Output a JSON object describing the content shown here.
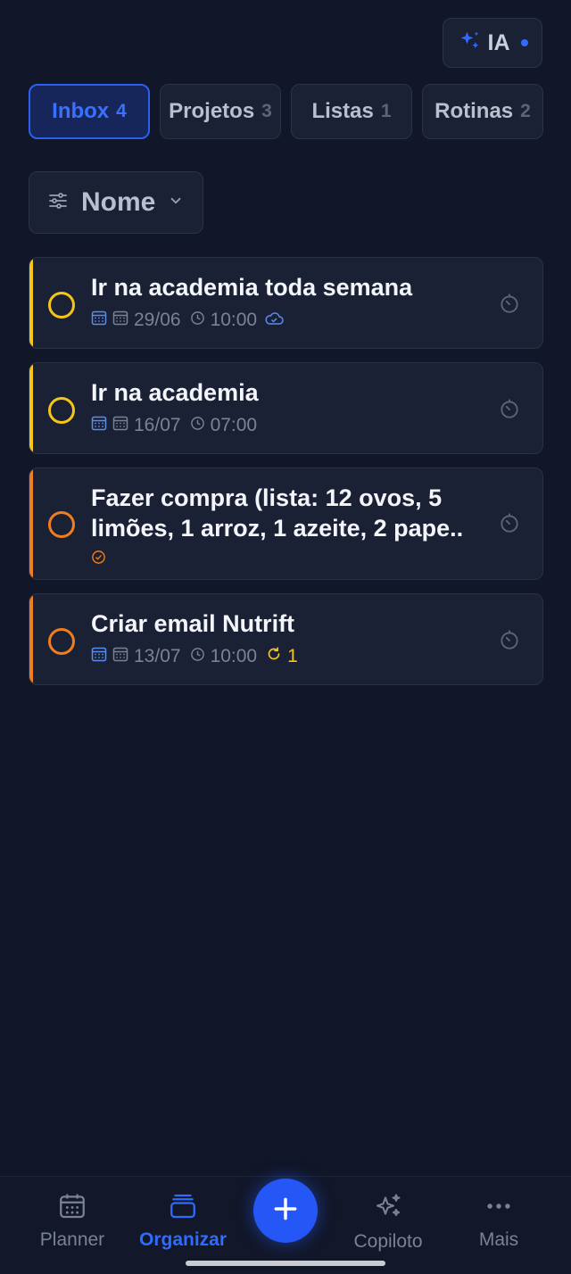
{
  "header": {
    "ia_label": "IA"
  },
  "tabs": [
    {
      "label": "Inbox",
      "count": "4",
      "active": true
    },
    {
      "label": "Projetos",
      "count": "3",
      "active": false
    },
    {
      "label": "Listas",
      "count": "1",
      "active": false
    },
    {
      "label": "Rotinas",
      "count": "2",
      "active": false
    }
  ],
  "sort": {
    "label": "Nome"
  },
  "tasks": [
    {
      "title": "Ir na academia toda semana",
      "date": "29/06",
      "time": "10:00",
      "priority_color": "#f5c518",
      "extra": "cloud"
    },
    {
      "title": "Ir na academia",
      "date": "16/07",
      "time": "07:00",
      "priority_color": "#f5c518",
      "extra": ""
    },
    {
      "title_line1": "Fazer compra (lista: 12 ovos, 5",
      "title_line2": "limões, 1 arroz, 1 azeite, 2 pape..",
      "priority_color": "#f07d1e",
      "extra": "check"
    },
    {
      "title": "Criar email Nutrift",
      "date": "13/07",
      "time": "10:00",
      "repeat_count": "1",
      "priority_color": "#f07d1e",
      "extra": "repeat"
    }
  ],
  "nav": {
    "planner": "Planner",
    "organizar": "Organizar",
    "copiloto": "Copiloto",
    "mais": "Mais"
  },
  "colors": {
    "accent": "#2f6bff",
    "background": "#111628",
    "card": "#1b2134",
    "yellow": "#f5c518",
    "orange": "#f07d1e"
  }
}
